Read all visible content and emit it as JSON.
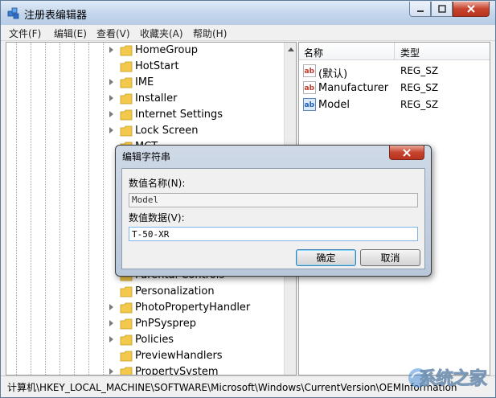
{
  "window": {
    "title": "注册表编辑器"
  },
  "menu": [
    "文件(F)",
    "编辑(E)",
    "查看(V)",
    "收藏夹(A)",
    "帮助(H)"
  ],
  "tree": {
    "items": [
      "HomeGroup",
      "HotStart",
      "IME",
      "Installer",
      "Internet Settings",
      "Lock Screen",
      "MCT",
      "Personalization",
      "PhotoPropertyHandler",
      "PnPSysprep",
      "Policies",
      "PreviewHandlers",
      "PropertySystem"
    ],
    "partial_label": "Parental Controls"
  },
  "list": {
    "columns": [
      "名称",
      "类型"
    ],
    "rows": [
      {
        "name": "(默认)",
        "type": "REG_SZ",
        "icon": "string-value-icon"
      },
      {
        "name": "Manufacturer",
        "type": "REG_SZ",
        "icon": "string-value-icon"
      },
      {
        "name": "Model",
        "type": "REG_SZ",
        "icon": "string-value-icon-blue"
      }
    ]
  },
  "dialog": {
    "title": "编辑字符串",
    "name_label": "数值名称(N):",
    "name_value": "Model",
    "data_label": "数值数据(V):",
    "data_value": "T-50-XR",
    "ok_label": "确定",
    "cancel_label": "取消"
  },
  "status": {
    "path": "计算机\\HKEY_LOCAL_MACHINE\\SOFTWARE\\Microsoft\\Windows\\CurrentVersion\\OEMInformation"
  },
  "watermark": {
    "text": "系统之家"
  },
  "colors": {
    "title_gradient_top": "#dfeaf7",
    "close_red": "#c7442e",
    "folder_yellow": "#f2c94c",
    "selection_blue": "#7eb4ea"
  }
}
